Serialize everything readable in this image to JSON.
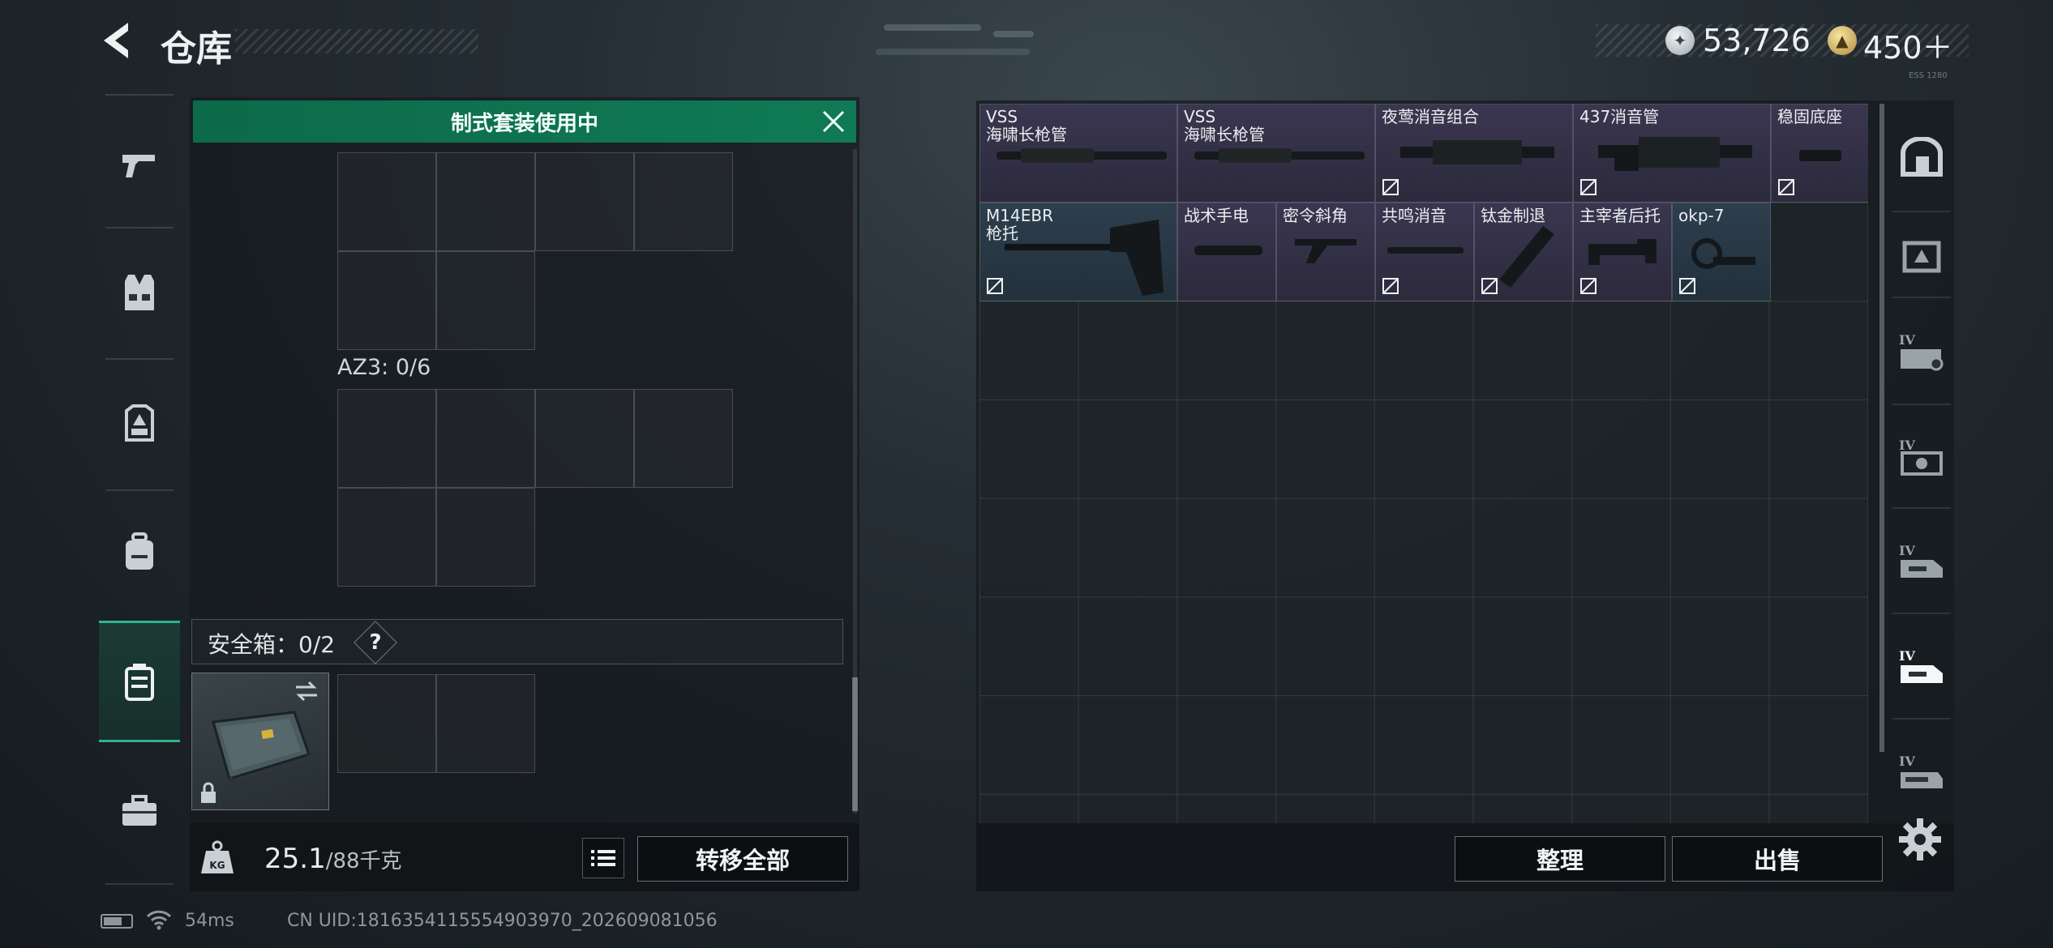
{
  "header": {
    "title": "仓库",
    "currency_silver": "53,726",
    "currency_gold": "450＋",
    "tiny_text": "ESS 1280"
  },
  "left_nav": {
    "items": [
      "pistol-icon",
      "vest-icon",
      "backpack-rig-icon",
      "backpack-icon",
      "secure-case-icon",
      "toolbox-icon"
    ],
    "active_index": 4
  },
  "loadout": {
    "banner": "制式套装使用中",
    "az3_label": "AZ3: 0/6",
    "safebox_label": "安全箱：0/2",
    "help_label": "?",
    "weight_value": "25.1",
    "weight_max": "/88千克",
    "weight_badge": "KG",
    "transfer_all": "转移全部"
  },
  "stash": {
    "items": [
      {
        "name": "VSS\n海啸长枪管",
        "rarity": "purple",
        "locked": false
      },
      {
        "name": "VSS\n海啸长枪管",
        "rarity": "purple",
        "locked": false
      },
      {
        "name": "夜莺消音组合",
        "rarity": "purple",
        "locked": true
      },
      {
        "name": "437消音管",
        "rarity": "purple",
        "locked": true
      },
      {
        "name": "稳固底座",
        "rarity": "purple",
        "locked": true
      },
      {
        "name": "M14EBR\n枪托",
        "rarity": "blue",
        "locked": true
      },
      {
        "name": "战术手电",
        "rarity": "purple",
        "locked": false
      },
      {
        "name": "密令斜角",
        "rarity": "purple",
        "locked": false
      },
      {
        "name": "共鸣消音",
        "rarity": "purple",
        "locked": true
      },
      {
        "name": "钛金制退",
        "rarity": "purple",
        "locked": true
      },
      {
        "name": "主宰者后托",
        "rarity": "purple",
        "locked": true
      },
      {
        "name": "okp-7",
        "rarity": "blue",
        "locked": true
      }
    ],
    "sort_label": "整理",
    "sell_label": "出售"
  },
  "right_nav": {
    "items": [
      "home-icon",
      "tier-iv-storage-icon",
      "tier-iv-gear-icon",
      "tier-iv-crate-icon",
      "tier-iv-truck-icon",
      "tier-iv-truck-selected-icon",
      "tier-iv-vehicle-icon"
    ],
    "tier_label": "IV",
    "active_index": 5
  },
  "status": {
    "ping": "54ms",
    "uid": "CN UID:1816354115554903970_202609081056"
  },
  "colors": {
    "accent_green": "#0f7a55",
    "rarity_purple": "#3a3650",
    "rarity_blue": "#2d3e4d"
  }
}
